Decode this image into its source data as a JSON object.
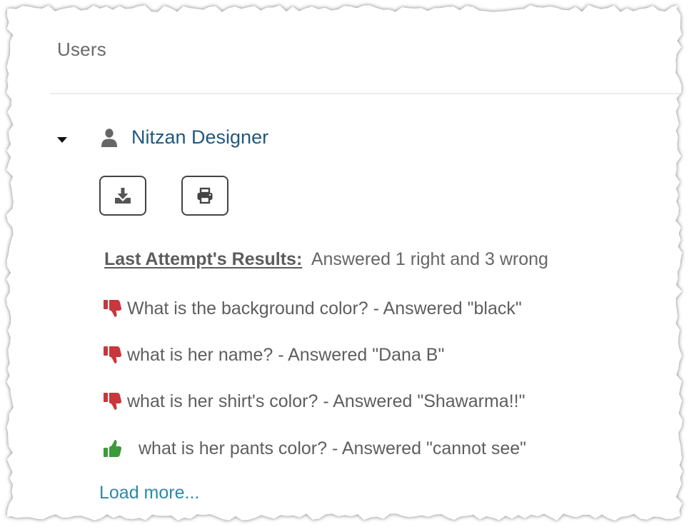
{
  "panel": {
    "title": "Users"
  },
  "user": {
    "name": "Nitzan Designer",
    "toolbar": [
      {
        "icon": "download-icon"
      },
      {
        "icon": "print-icon"
      }
    ]
  },
  "results": {
    "label": "Last Attempt's Results:",
    "summary": "Answered 1 right and 3 wrong",
    "answers": [
      {
        "status": "wrong",
        "icon": "thumbs-down-icon",
        "text": "What is the background color? - Answered \"black\""
      },
      {
        "status": "wrong",
        "icon": "thumbs-down-icon",
        "text": "what is her name? - Answered \"Dana B\""
      },
      {
        "status": "wrong",
        "icon": "thumbs-down-icon",
        "text": "what is her shirt's color? - Answered \"Shawarma!!\""
      },
      {
        "status": "right",
        "icon": "thumbs-up-icon",
        "text": "what is her pants color? - Answered \"cannot see\""
      }
    ],
    "load_more": "Load more..."
  },
  "colors": {
    "link": "#21597e",
    "load_more": "#2b8ba4",
    "wrong": "#c8373b",
    "right": "#3c9a3c",
    "text": "#5e5e5e"
  }
}
